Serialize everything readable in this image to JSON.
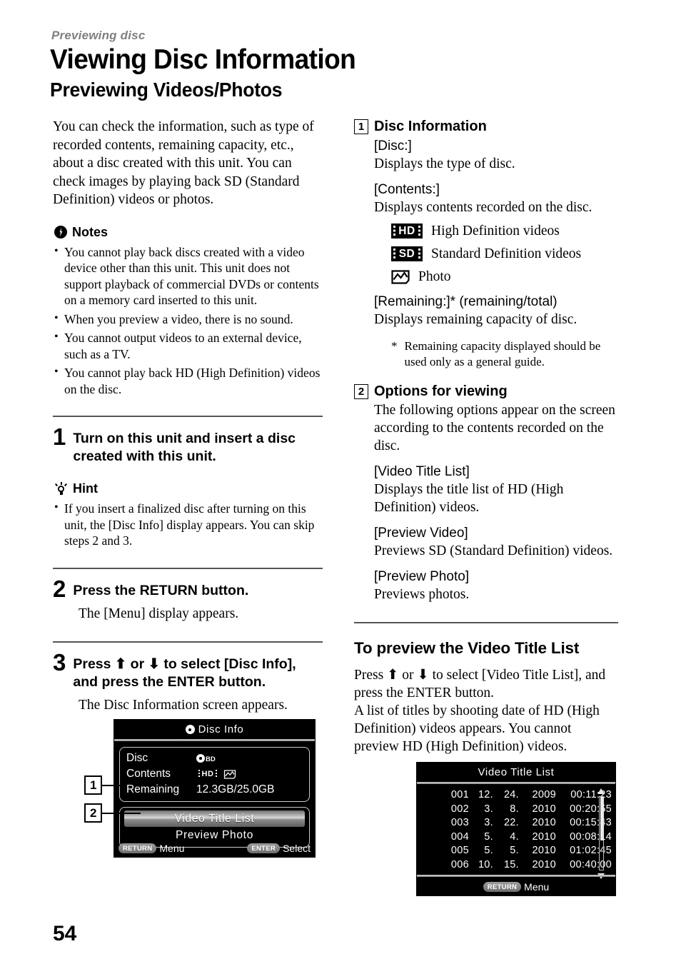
{
  "header": {
    "kicker": "Previewing disc",
    "title": "Viewing Disc Information",
    "subtitle": "Previewing Videos/Photos"
  },
  "left": {
    "intro": "You can check the information, such as type of recorded contents, remaining capacity, etc., about a disc created with this unit. You can check images by playing back SD (Standard Definition) videos or photos.",
    "notes_label": "Notes",
    "notes": [
      "You cannot play back discs created with a video device other than this unit. This unit does not support playback of commercial DVDs or contents on a memory card inserted to this unit.",
      "When you preview a video, there is no sound.",
      "You cannot output videos to an external device, such as a TV.",
      "You cannot play back HD (High Definition) videos on the disc."
    ],
    "steps": [
      {
        "number": "1",
        "heading": "Turn on this unit and insert a disc created with this unit.",
        "body": ""
      },
      {
        "number": "2",
        "heading": "Press the RETURN button.",
        "body": "The [Menu] display appears."
      },
      {
        "number": "3",
        "heading": "Press ⬆ or ⬇ to select [Disc Info], and press the ENTER button.",
        "body": "The Disc Information screen appears."
      }
    ],
    "hint_label": "Hint",
    "hint": "If you insert a finalized disc after turning on this unit, the [Disc Info] display appears. You can skip steps 2 and 3."
  },
  "disc_screen": {
    "title": "Disc  Info",
    "rows": [
      {
        "key": "Disc",
        "value": "BD"
      },
      {
        "key": "Contents",
        "value": "HD"
      },
      {
        "key": "Remaining",
        "value": "12.3GB/25.0GB"
      }
    ],
    "contents_hd_label": "HD",
    "disc_type_label": "BD",
    "options": [
      {
        "label": "Video  Title  List",
        "selected": true
      },
      {
        "label": "Preview  Photo",
        "selected": false
      }
    ],
    "footer": {
      "left_key": "RETURN",
      "left_label": "Menu",
      "right_key": "ENTER",
      "right_label": "Select"
    },
    "marker_1": "1",
    "marker_2": "2"
  },
  "right": {
    "section1": {
      "number": "1",
      "heading": "Disc Information",
      "items": [
        {
          "label": "[Disc:]",
          "desc": "Displays the type of disc."
        },
        {
          "label": "[Contents:]",
          "desc": "Displays contents recorded on the disc."
        }
      ],
      "badges": [
        {
          "icon": "hd-badge",
          "text": "High Definition videos"
        },
        {
          "icon": "sd-badge",
          "text": "Standard Definition videos"
        },
        {
          "icon": "photo-icon",
          "text": "Photo"
        }
      ],
      "remaining_label": "[Remaining:]* (remaining/total)",
      "remaining_desc": "Displays remaining capacity of disc.",
      "footnote_star": "*",
      "footnote_text": "Remaining capacity displayed should be used only as a general guide."
    },
    "section2": {
      "number": "2",
      "heading": "Options for viewing",
      "intro": "The following options appear on the screen according to the contents recorded on the disc.",
      "items": [
        {
          "label": "[Video Title List]",
          "desc": "Displays the title list of HD (High Definition) videos."
        },
        {
          "label": "[Preview Video]",
          "desc": "Previews SD (Standard Definition) videos."
        },
        {
          "label": "[Preview Photo]",
          "desc": "Previews photos."
        }
      ]
    },
    "section3": {
      "heading": "To preview the Video Title List",
      "body": "Press ⬆ or ⬇ to select [Video Title List], and press the ENTER button.\nA list of titles by shooting date of HD (High Definition) videos appears. You cannot preview HD (High Definition) videos."
    }
  },
  "vtl_screen": {
    "title": "Video  Title  List",
    "rows": [
      {
        "no": "001",
        "mm": "12.",
        "dd": "24.",
        "yyyy": "2009",
        "dur": "00:11:23"
      },
      {
        "no": "002",
        "mm": "3.",
        "dd": "8.",
        "yyyy": "2010",
        "dur": "00:20:55"
      },
      {
        "no": "003",
        "mm": "3.",
        "dd": "22.",
        "yyyy": "2010",
        "dur": "00:15:43"
      },
      {
        "no": "004",
        "mm": "5.",
        "dd": "4.",
        "yyyy": "2010",
        "dur": "00:08:14"
      },
      {
        "no": "005",
        "mm": "5.",
        "dd": "5.",
        "yyyy": "2010",
        "dur": "01:02:45"
      },
      {
        "no": "006",
        "mm": "10.",
        "dd": "15.",
        "yyyy": "2010",
        "dur": "00:40:00"
      }
    ],
    "footer": {
      "key": "RETURN",
      "label": "Menu"
    }
  },
  "page_number": "54"
}
